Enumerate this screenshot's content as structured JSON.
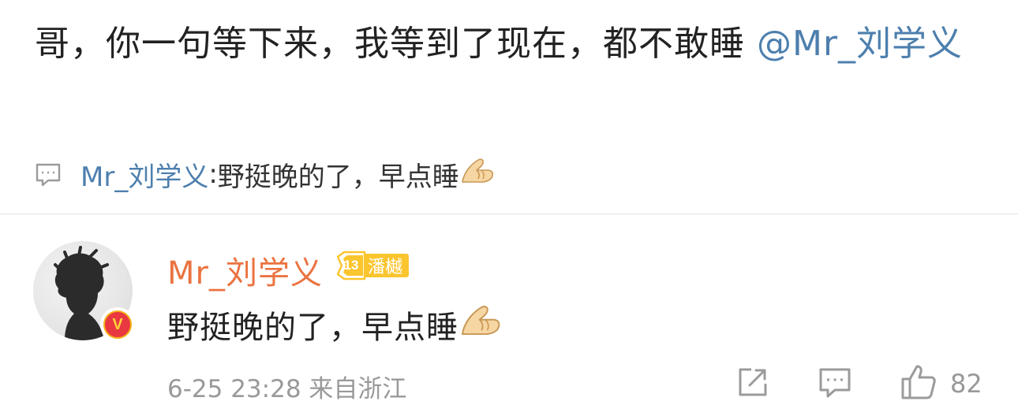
{
  "post": {
    "text": "哥，你一句等下来，我等到了现在，都不敢睡 ",
    "mention": "@Mr_刘学义",
    "reply_preview": {
      "author": "Mr_刘学义",
      "separator": ": ",
      "text": "野挺晚的了，早点睡"
    }
  },
  "comment": {
    "author": "Mr_刘学义",
    "level_number": "13",
    "level_title": "潘樾",
    "text": "野挺晚的了，早点睡",
    "timestamp": "6-25 23:28",
    "location": "来自浙江",
    "like_count": "82",
    "verified_badge": "V"
  },
  "icons": {
    "reply_preview_icon": "comment-bubble-icon",
    "emoji": "pinched-fingers-emoji",
    "share": "share-icon",
    "comment": "comment-icon",
    "like": "thumbs-up-icon"
  },
  "colors": {
    "link_blue": "#4d7fae",
    "author_orange": "#eb7340",
    "meta_gray": "#999999",
    "badge_yellow": "#fbc52e"
  }
}
